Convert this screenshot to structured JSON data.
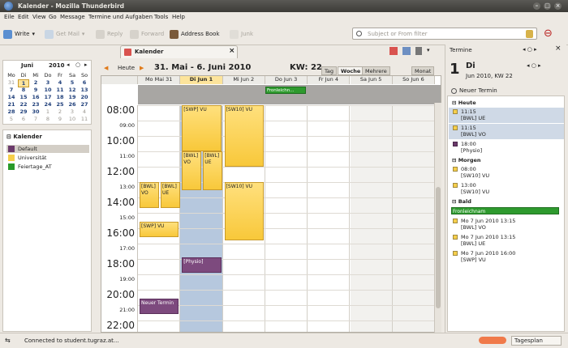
{
  "window": {
    "title": "Kalender - Mozilla Thunderbird"
  },
  "menu": [
    "Eile",
    "Edit",
    "View",
    "Go",
    "Message",
    "Termine und Aufgaben",
    "Tools",
    "Help"
  ],
  "toolbar": {
    "write": "Write",
    "get_mail": "Get Mail",
    "reply": "Reply",
    "forward": "Forward",
    "address_book": "Address Book",
    "junk": "Junk",
    "search_placeholder": "Subject or From filter"
  },
  "tab": {
    "label": "Kalender"
  },
  "minical": {
    "month": "Juni",
    "year": "2010",
    "dow": [
      "Mo",
      "Di",
      "Mi",
      "Do",
      "Fr",
      "Sa",
      "So"
    ],
    "weeks": [
      [
        "31",
        "1",
        "2",
        "3",
        "4",
        "5",
        "6"
      ],
      [
        "7",
        "8",
        "9",
        "10",
        "11",
        "12",
        "13"
      ],
      [
        "14",
        "15",
        "16",
        "17",
        "18",
        "19",
        "20"
      ],
      [
        "21",
        "22",
        "23",
        "24",
        "25",
        "26",
        "27"
      ],
      [
        "28",
        "29",
        "30",
        "1",
        "2",
        "3",
        "4"
      ],
      [
        "5",
        "6",
        "7",
        "8",
        "9",
        "10",
        "11"
      ]
    ]
  },
  "calendars": {
    "heading": "Kalender",
    "items": [
      {
        "name": "Default",
        "color": "#6b3a6b"
      },
      {
        "name": "Universität",
        "color": "#f6cf4b"
      },
      {
        "name": "Feiertage_AT",
        "color": "#2a9a2a"
      }
    ]
  },
  "nav": {
    "today": "Heute",
    "range": "31. Mai - 6. Juni 2010",
    "kw": "KW: 22"
  },
  "views": [
    "Tag",
    "Woche",
    "Mehrere Wochen",
    "Monat"
  ],
  "days": [
    "Mo Mai 31",
    "Di Jun 1",
    "Mi Jun 2",
    "Do Jun 3",
    "Fr Jun 4",
    "Sa Jun 5",
    "So Jun 6"
  ],
  "allday_event": "Fronleichn...",
  "times": [
    "08:00",
    "09:00",
    "10:00",
    "11:00",
    "12:00",
    "13:00",
    "14:00",
    "15:00",
    "16:00",
    "17:00",
    "18:00",
    "19:00",
    "20:00",
    "21:00",
    "22:00"
  ],
  "events": {
    "swp1": "[SWP] VU",
    "sw10a": "[SW10] VU",
    "bwl_vo1": "[BWL] VO",
    "bwl_ue1": "[BWL] UE",
    "bwl_vo2": "[BWL] VO",
    "bwl_ue2": "[BWL] UE",
    "sw10b": "[SW10] VU",
    "swp2": "[SWP] VU",
    "physio": "[Physio]",
    "neuer": "Neuer Termin"
  },
  "right": {
    "title": "Termine",
    "day_num": "1",
    "day_name": "Di",
    "date": "Jun 2010, KW 22",
    "new": "Neuer Termin",
    "sections": {
      "today": "Heute",
      "tomorrow": "Morgen",
      "soon": "Bald"
    },
    "today_items": [
      [
        "11:15",
        "[BWL] UE"
      ],
      [
        "11:15",
        "[BWL] VO"
      ],
      [
        "18:00",
        "[Physio]"
      ]
    ],
    "tomorrow_items": [
      [
        "08:00",
        "[SW10] VU"
      ],
      [
        "13:00",
        "[SW10] VU"
      ]
    ],
    "soon_banner": "Fronleichnam",
    "soon_items": [
      [
        "Mo 7 Jun 2010 13:15",
        "[BWL] VO"
      ],
      [
        "Mo 7 Jun 2010 13:15",
        "[BWL] UE"
      ],
      [
        "Mo 7 Jun 2010 16:00",
        "[SWP] VU"
      ]
    ]
  },
  "status": {
    "text": "Connected to student.tugraz.at...",
    "pane": "Tagesplan"
  }
}
